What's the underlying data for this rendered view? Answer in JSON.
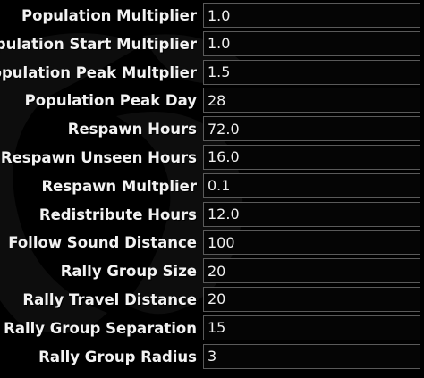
{
  "settings": [
    {
      "label": "Population Multiplier",
      "value": "1.0"
    },
    {
      "label": "Population Start Multiplier",
      "value": "1.0"
    },
    {
      "label": "Population Peak Multplier",
      "value": "1.5"
    },
    {
      "label": "Population Peak Day",
      "value": "28"
    },
    {
      "label": "Respawn Hours",
      "value": "72.0"
    },
    {
      "label": "Respawn Unseen Hours",
      "value": "16.0"
    },
    {
      "label": "Respawn Multplier",
      "value": "0.1"
    },
    {
      "label": "Redistribute Hours",
      "value": "12.0"
    },
    {
      "label": "Follow Sound Distance",
      "value": "100"
    },
    {
      "label": "Rally Group Size",
      "value": "20"
    },
    {
      "label": "Rally Travel Distance",
      "value": "20"
    },
    {
      "label": "Rally Group Separation",
      "value": "15"
    },
    {
      "label": "Rally Group Radius",
      "value": "3"
    }
  ],
  "colors": {
    "background": "#000000",
    "label_text": "#f2f2f2",
    "field_border": "#5a5a5a"
  }
}
